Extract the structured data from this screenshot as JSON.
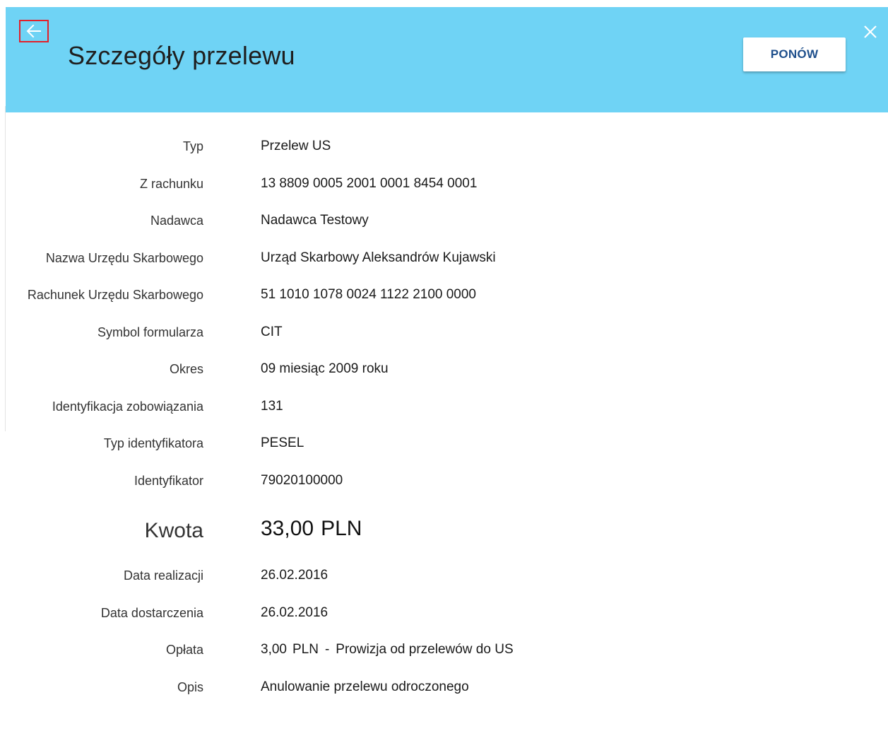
{
  "header": {
    "title": "Szczegóły przelewu",
    "back_icon": "arrow-left-icon",
    "close_icon": "close-icon",
    "retry_label": "PONÓW",
    "background_color": "#6fd3f5",
    "back_highlight_color": "#e3202a"
  },
  "details": {
    "type": {
      "label": "Typ",
      "value": "Przelew US"
    },
    "from_account": {
      "label": "Z rachunku",
      "value": "13 8809 0005 2001 0001 8454 0001"
    },
    "sender": {
      "label": "Nadawca",
      "value": "Nadawca Testowy"
    },
    "tax_office_name": {
      "label": "Nazwa Urzędu Skarbowego",
      "value": "Urząd Skarbowy Aleksandrów Kujawski"
    },
    "tax_office_account": {
      "label": "Rachunek Urzędu Skarbowego",
      "value": "51 1010 1078 0024 1122 2100 0000"
    },
    "form_symbol": {
      "label": "Symbol formularza",
      "value": "CIT"
    },
    "period": {
      "label": "Okres",
      "value": "09 miesiąc 2009 roku"
    },
    "obligation_id": {
      "label": "Identyfikacja zobowiązania",
      "value": "131"
    },
    "identifier_type": {
      "label": "Typ identyfikatora",
      "value": "PESEL"
    },
    "identifier": {
      "label": "Identyfikator",
      "value": "79020100000"
    },
    "amount": {
      "label": "Kwota",
      "value": "33,00",
      "currency": "PLN"
    },
    "execution_date": {
      "label": "Data realizacji",
      "value": "26.02.2016"
    },
    "delivery_date": {
      "label": "Data dostarczenia",
      "value": "26.02.2016"
    },
    "fee": {
      "label": "Opłata",
      "value": "3,00",
      "currency": "PLN",
      "separator": "-",
      "description": "Prowizja od przelewów do US"
    },
    "description": {
      "label": "Opis",
      "value": "Anulowanie przelewu odroczonego"
    }
  }
}
